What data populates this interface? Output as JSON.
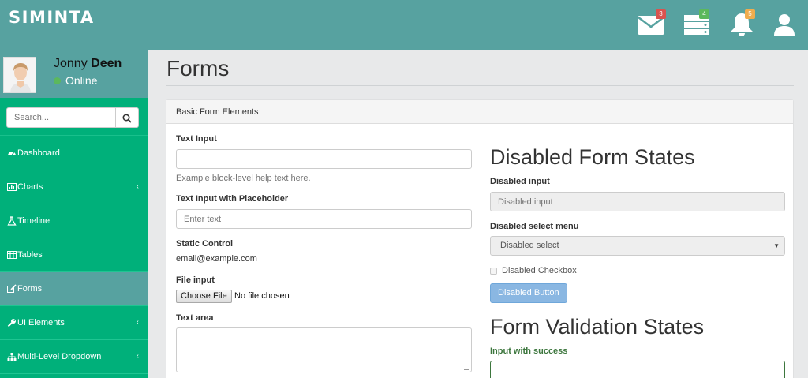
{
  "app": {
    "brand": "SIMINTA"
  },
  "topbar": {
    "messages_badge": "3",
    "tasks_badge": "4",
    "alerts_badge": "5",
    "icons": [
      "envelope-icon",
      "tasks-icon",
      "bell-icon",
      "user-icon"
    ]
  },
  "user": {
    "first_name": "Jonny",
    "last_name": "Deen",
    "status": "Online"
  },
  "search": {
    "placeholder": "Search..."
  },
  "sidebar": {
    "items": [
      {
        "label": "Dashboard",
        "icon": "dashboard-icon",
        "has_submenu": false
      },
      {
        "label": "Charts",
        "icon": "bar-chart-icon",
        "has_submenu": true
      },
      {
        "label": "Timeline",
        "icon": "flask-icon",
        "has_submenu": false
      },
      {
        "label": "Tables",
        "icon": "table-icon",
        "has_submenu": false
      },
      {
        "label": "Forms",
        "icon": "edit-icon",
        "has_submenu": false,
        "active": true
      },
      {
        "label": "UI Elements",
        "icon": "wrench-icon",
        "has_submenu": true
      },
      {
        "label": "Multi-Level Dropdown",
        "icon": "sitemap-icon",
        "has_submenu": true
      }
    ],
    "chevron": "‹"
  },
  "page": {
    "title": "Forms"
  },
  "panel": {
    "heading": "Basic Form Elements",
    "left": {
      "text_input_label": "Text Input",
      "text_input_value": "",
      "text_input_help": "Example block-level help text here.",
      "placeholder_label": "Text Input with Placeholder",
      "placeholder_text": "Enter text",
      "static_label": "Static Control",
      "static_value": "email@example.com",
      "file_label": "File input",
      "file_button": "Choose File",
      "file_status": "No file chosen",
      "textarea_label": "Text area"
    },
    "right": {
      "disabled_heading": "Disabled Form States",
      "disabled_input_label": "Disabled input",
      "disabled_input_placeholder": "Disabled input",
      "disabled_select_label": "Disabled select menu",
      "disabled_select_value": "Disabled select",
      "disabled_checkbox_label": "Disabled Checkbox",
      "disabled_button": "Disabled Button",
      "validation_heading": "Form Validation States",
      "success_label": "Input with success"
    }
  },
  "colors": {
    "topbar": "#57a2a0",
    "sidebar": "#00b07a",
    "success": "#3c763d",
    "disabled_button": "#8ab7e2"
  }
}
